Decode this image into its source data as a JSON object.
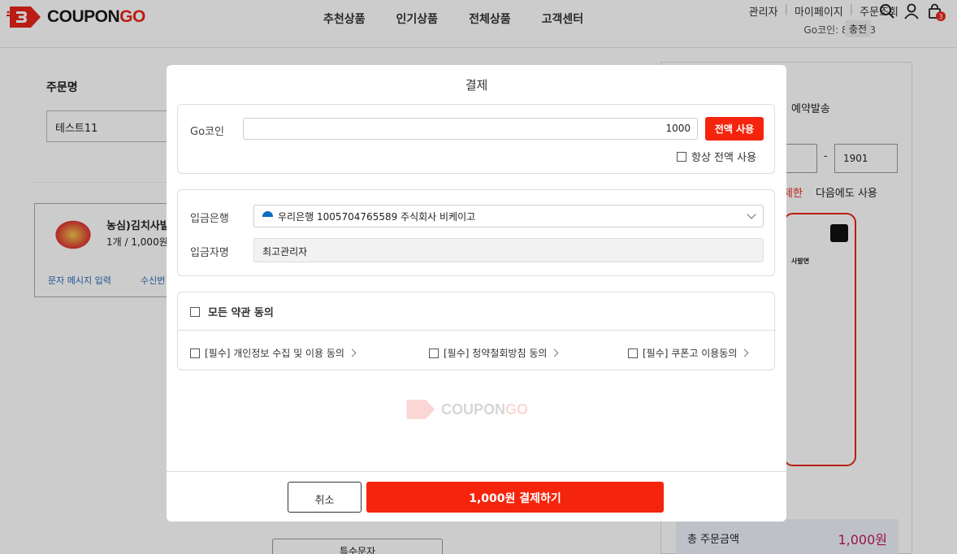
{
  "header": {
    "logo_text_main": "COUPON",
    "logo_text_accent": "GO",
    "nav": [
      "추천상품",
      "인기상품",
      "전체상품",
      "고객센터"
    ],
    "util_links": [
      "관리자",
      "마이페이지",
      "주문조회"
    ],
    "coin_label": "Go코인: 85,903",
    "charge_label": "충전",
    "cart_count": "3"
  },
  "background": {
    "order_name_label": "주문명",
    "order_name_value": "테스트11",
    "product_name": "농심)김치사발",
    "product_qty": "1개 / 1,000원",
    "sms_link": "문자 메시지 입력",
    "receiver_link": "수신번",
    "reserve_label": "예약발송",
    "phone_part": "1901",
    "limit_text": "제한",
    "next_use": "다음에도 사용",
    "card_title": "사발면",
    "special_btn": "특수문자",
    "total_label": "총 주문금액",
    "total_value": "1,000원"
  },
  "modal": {
    "title": "결제",
    "coin": {
      "label": "Go코인",
      "value": "1000",
      "fill_button": "전액 사용",
      "always_label": "항상 전액 사용"
    },
    "bank": {
      "label": "입금은행",
      "selected": "우리은행 1005704765589 주식회사 비케이고",
      "payer_label": "입금자명",
      "payer_value": "최고관리자"
    },
    "terms": {
      "agree_all": "모든 약관 동의",
      "items": [
        "[필수] 개인정보 수집 및 이용 동의",
        "[필수] 청약철회방침 동의",
        "[필수] 쿠폰고 이용동의"
      ]
    },
    "watermark_main": "COUPON",
    "watermark_accent": "GO",
    "cancel_button": "취소",
    "pay_button": "1,000원 결제하기"
  },
  "colors": {
    "accent": "#f4250c",
    "overlay": "rgba(0,0,0,0.2)"
  },
  "icons": [
    "search-icon",
    "user-icon",
    "cart-icon",
    "gear-icon",
    "chevron-down-icon",
    "chevron-right-icon",
    "bank-logo-icon"
  ]
}
